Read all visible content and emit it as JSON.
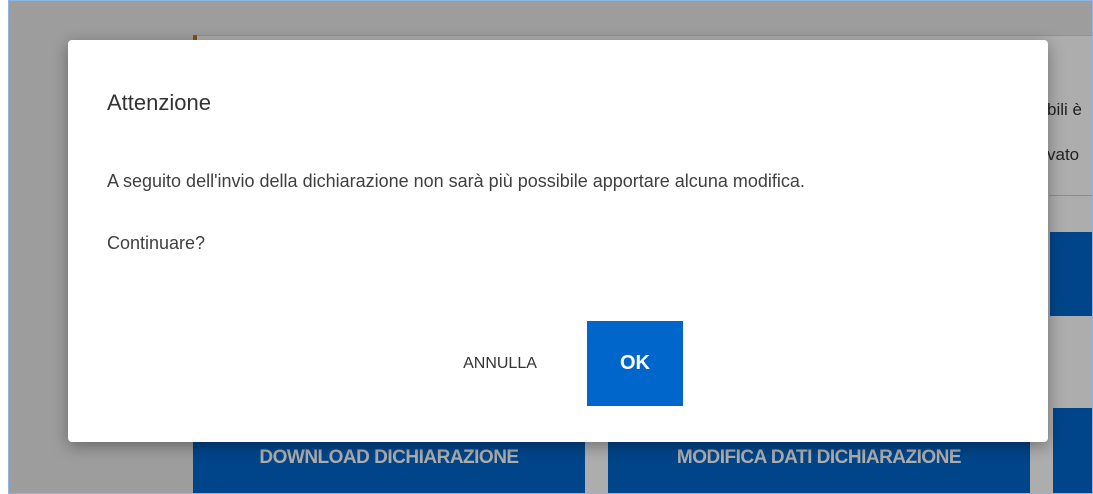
{
  "background": {
    "partial_text_1": "bili è",
    "partial_text_2": "vato",
    "download_button_label": "DOWNLOAD DICHIARAZIONE",
    "modify_button_label": "MODIFICA DATI DICHIARAZIONE"
  },
  "dialog": {
    "title": "Attenzione",
    "message": "A seguito dell'invio della dichiarazione non sarà più possibile apportare alcuna modifica.",
    "question": "Continuare?",
    "cancel_label": "ANNULLA",
    "ok_label": "OK"
  },
  "colors": {
    "primary": "#0066cc",
    "accent_mark": "#c07a1a"
  }
}
